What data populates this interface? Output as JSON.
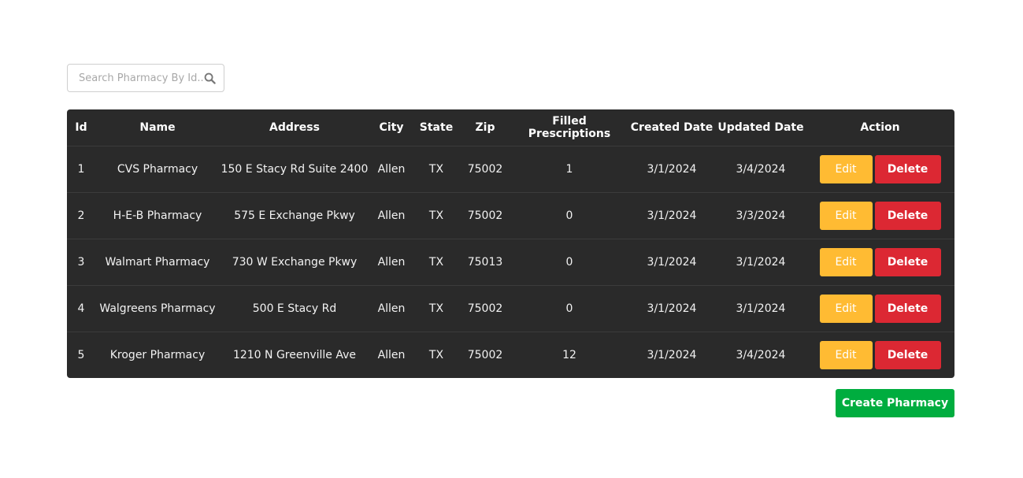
{
  "search": {
    "placeholder": "Search Pharmacy By Id..."
  },
  "table": {
    "headers": [
      "Id",
      "Name",
      "Address",
      "City",
      "State",
      "Zip",
      "Filled Prescriptions",
      "Created Date",
      "Updated Date",
      "Action"
    ],
    "rows": [
      {
        "id": "1",
        "name": "CVS Pharmacy",
        "address": "150 E Stacy Rd Suite 2400",
        "city": "Allen",
        "state": "TX",
        "zip": "75002",
        "filled": "1",
        "created": "3/1/2024",
        "updated": "3/4/2024"
      },
      {
        "id": "2",
        "name": "H-E-B Pharmacy",
        "address": "575 E Exchange Pkwy",
        "city": "Allen",
        "state": "TX",
        "zip": "75002",
        "filled": "0",
        "created": "3/1/2024",
        "updated": "3/3/2024"
      },
      {
        "id": "3",
        "name": "Walmart Pharmacy",
        "address": "730 W Exchange Pkwy",
        "city": "Allen",
        "state": "TX",
        "zip": "75013",
        "filled": "0",
        "created": "3/1/2024",
        "updated": "3/1/2024"
      },
      {
        "id": "4",
        "name": "Walgreens Pharmacy",
        "address": "500 E Stacy Rd",
        "city": "Allen",
        "state": "TX",
        "zip": "75002",
        "filled": "0",
        "created": "3/1/2024",
        "updated": "3/1/2024"
      },
      {
        "id": "5",
        "name": "Kroger Pharmacy",
        "address": "1210 N Greenville Ave",
        "city": "Allen",
        "state": "TX",
        "zip": "75002",
        "filled": "12",
        "created": "3/1/2024",
        "updated": "3/4/2024"
      }
    ],
    "edit_label": "Edit",
    "delete_label": "Delete"
  },
  "create_label": "Create Pharmacy",
  "icons": {
    "search": "search-icon"
  },
  "colors": {
    "table_bg": "#2a2a2a",
    "edit": "#ffbb33",
    "delete": "#dc2833",
    "create": "#00ad3f"
  }
}
